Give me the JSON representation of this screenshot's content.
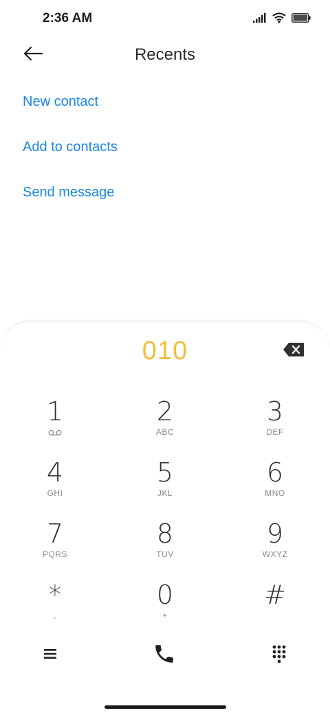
{
  "status_bar": {
    "time": "2:36 AM"
  },
  "header": {
    "title": "Recents"
  },
  "actions": [
    {
      "label": "New contact"
    },
    {
      "label": "Add to contacts"
    },
    {
      "label": "Send message"
    }
  ],
  "dialer": {
    "number": "010",
    "keys": [
      {
        "digit": "1",
        "letters": ""
      },
      {
        "digit": "2",
        "letters": "ABC"
      },
      {
        "digit": "3",
        "letters": "DEF"
      },
      {
        "digit": "4",
        "letters": "GHI"
      },
      {
        "digit": "5",
        "letters": "JKL"
      },
      {
        "digit": "6",
        "letters": "MNO"
      },
      {
        "digit": "7",
        "letters": "PQRS"
      },
      {
        "digit": "8",
        "letters": "TUV"
      },
      {
        "digit": "9",
        "letters": "WXYZ"
      },
      {
        "digit": "*",
        "letters": ","
      },
      {
        "digit": "0",
        "letters": "+"
      },
      {
        "digit": "#",
        "letters": ""
      }
    ]
  },
  "colors": {
    "accent_link": "#1d86e0",
    "dialed_number": "#f2bd3c"
  }
}
